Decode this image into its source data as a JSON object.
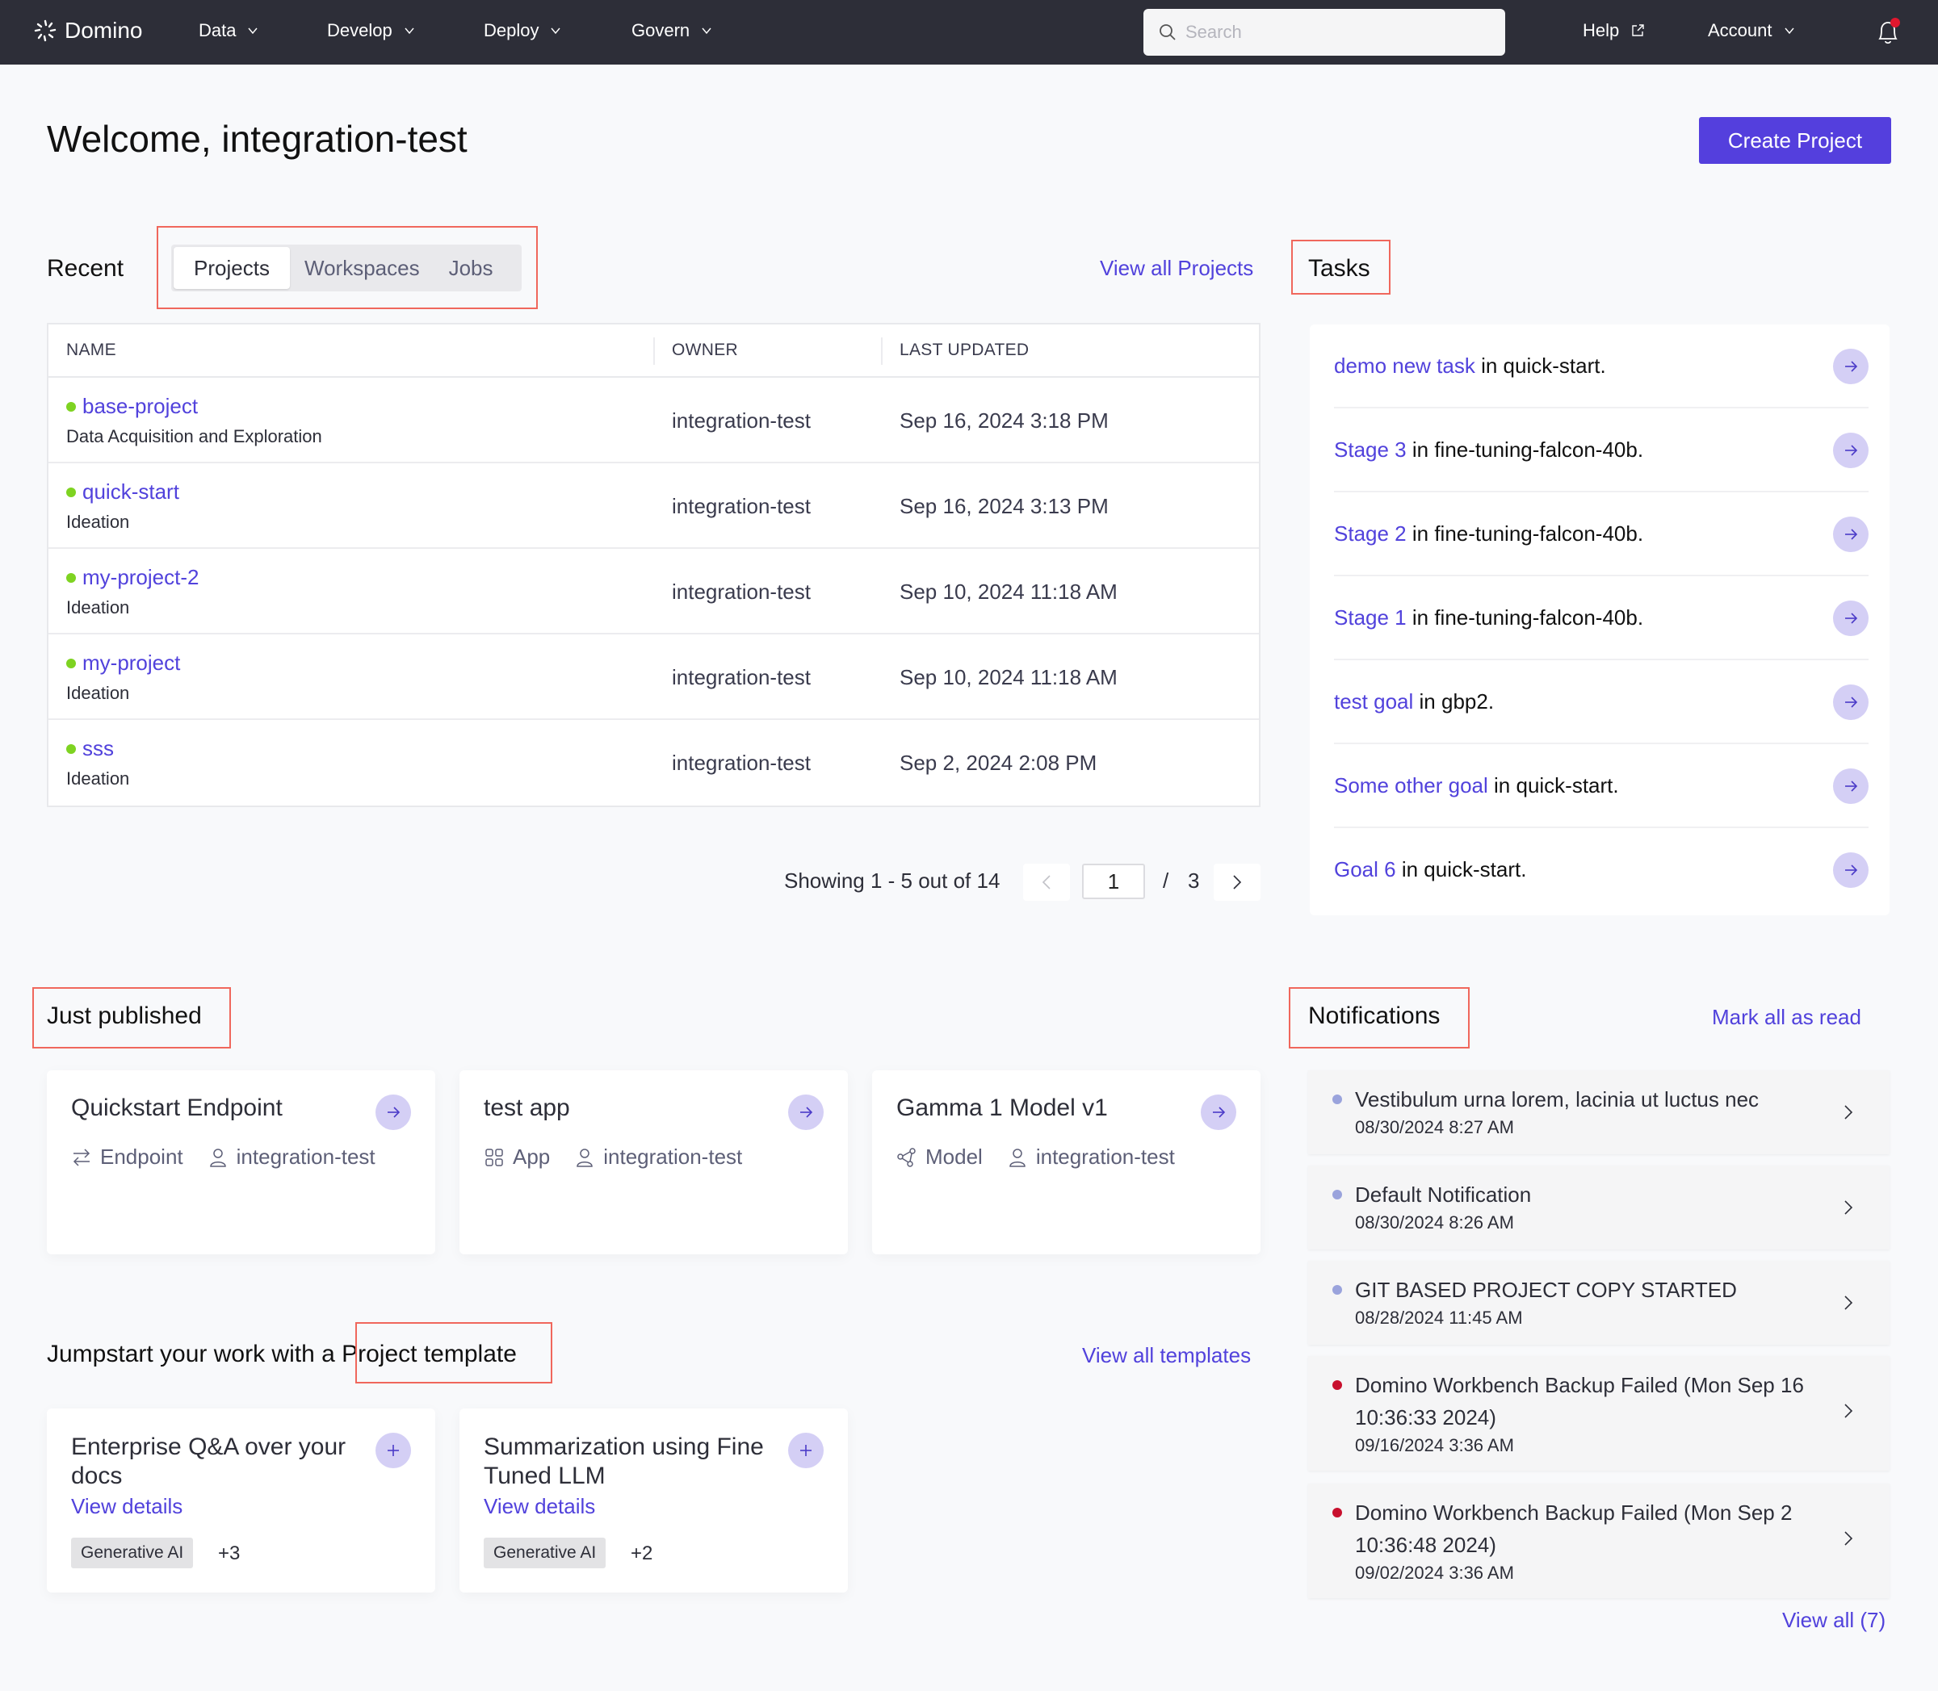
{
  "nav": {
    "brand": "Domino",
    "items": [
      {
        "label": "Data",
        "icon": "chevron-down-icon"
      },
      {
        "label": "Develop",
        "icon": "chevron-down-icon"
      },
      {
        "label": "Deploy",
        "icon": "chevron-down-icon"
      },
      {
        "label": "Govern",
        "icon": "chevron-down-icon"
      }
    ],
    "search_placeholder": "Search",
    "help_label": "Help",
    "account_label": "Account",
    "notification_badge_color": "#e0172e"
  },
  "header": {
    "welcome": "Welcome, integration-test",
    "create_project": "Create Project"
  },
  "recent": {
    "title": "Recent",
    "tabs": [
      {
        "label": "Projects",
        "active": true
      },
      {
        "label": "Workspaces",
        "active": false
      },
      {
        "label": "Jobs",
        "active": false
      }
    ],
    "view_all": "View all Projects",
    "columns": [
      "NAME",
      "OWNER",
      "LAST UPDATED"
    ],
    "rows": [
      {
        "name": "base-project",
        "stage": "Data Acquisition and Exploration",
        "owner": "integration-test",
        "updated": "Sep 16, 2024 3:18 PM"
      },
      {
        "name": "quick-start",
        "stage": "Ideation",
        "owner": "integration-test",
        "updated": "Sep 16, 2024 3:13 PM"
      },
      {
        "name": "my-project-2",
        "stage": "Ideation",
        "owner": "integration-test",
        "updated": "Sep 10, 2024 11:18 AM"
      },
      {
        "name": "my-project",
        "stage": "Ideation",
        "owner": "integration-test",
        "updated": "Sep 10, 2024 11:18 AM"
      },
      {
        "name": "sss",
        "stage": "Ideation",
        "owner": "integration-test",
        "updated": "Sep 2, 2024 2:08 PM"
      }
    ],
    "pagination": {
      "showing": "Showing 1 - 5 out of 14",
      "current_page": "1",
      "separator": "/",
      "total_pages": "3"
    }
  },
  "tasks": {
    "title": "Tasks",
    "items": [
      {
        "link": "demo new task",
        "rest": " in quick-start."
      },
      {
        "link": "Stage 3",
        "rest": " in fine-tuning-falcon-40b."
      },
      {
        "link": "Stage 2",
        "rest": " in fine-tuning-falcon-40b."
      },
      {
        "link": "Stage 1",
        "rest": " in fine-tuning-falcon-40b."
      },
      {
        "link": "test goal",
        "rest": " in gbp2."
      },
      {
        "link": "Some other goal",
        "rest": " in quick-start."
      },
      {
        "link": "Goal 6",
        "rest": " in quick-start."
      }
    ]
  },
  "published": {
    "title": "Just published",
    "cards": [
      {
        "title": "Quickstart Endpoint",
        "type": "Endpoint",
        "type_icon": "endpoint-arrows-icon",
        "owner": "integration-test"
      },
      {
        "title": "test app",
        "type": "App",
        "type_icon": "app-grid-icon",
        "owner": "integration-test"
      },
      {
        "title": "Gamma 1 Model v1",
        "type": "Model",
        "type_icon": "model-nodes-icon",
        "owner": "integration-test"
      }
    ]
  },
  "templates": {
    "title_prefix": "Jumpstart your work with a ",
    "title_highlight": "Project template",
    "view_all": "View all templates",
    "cards": [
      {
        "title": "Enterprise Q&A over your docs",
        "link": "View details",
        "tag": "Generative AI",
        "more": "+3"
      },
      {
        "title": "Summarization using Fine Tuned LLM",
        "link": "View details",
        "tag": "Generative AI",
        "more": "+2"
      }
    ]
  },
  "notifications": {
    "title": "Notifications",
    "mark_all": "Mark all as read",
    "view_all": "View all (7)",
    "items": [
      {
        "title": "Vestibulum urna lorem, lacinia ut luctus nec",
        "time": "08/30/2024 8:27 AM",
        "dot_color": "#9aa3dc"
      },
      {
        "title": "Default Notification",
        "time": "08/30/2024 8:26 AM",
        "dot_color": "#9aa3dc"
      },
      {
        "title": "GIT BASED PROJECT COPY STARTED",
        "time": "08/28/2024 11:45 AM",
        "dot_color": "#9aa3dc"
      },
      {
        "title": "Domino Workbench Backup Failed (Mon Sep 16 10:36:33 2024)",
        "time": "09/16/2024 3:36 AM",
        "dot_color": "#c8102e"
      },
      {
        "title": "Domino Workbench Backup Failed (Mon Sep 2 10:36:48 2024)",
        "time": "09/02/2024 3:36 AM",
        "dot_color": "#c8102e"
      }
    ]
  }
}
